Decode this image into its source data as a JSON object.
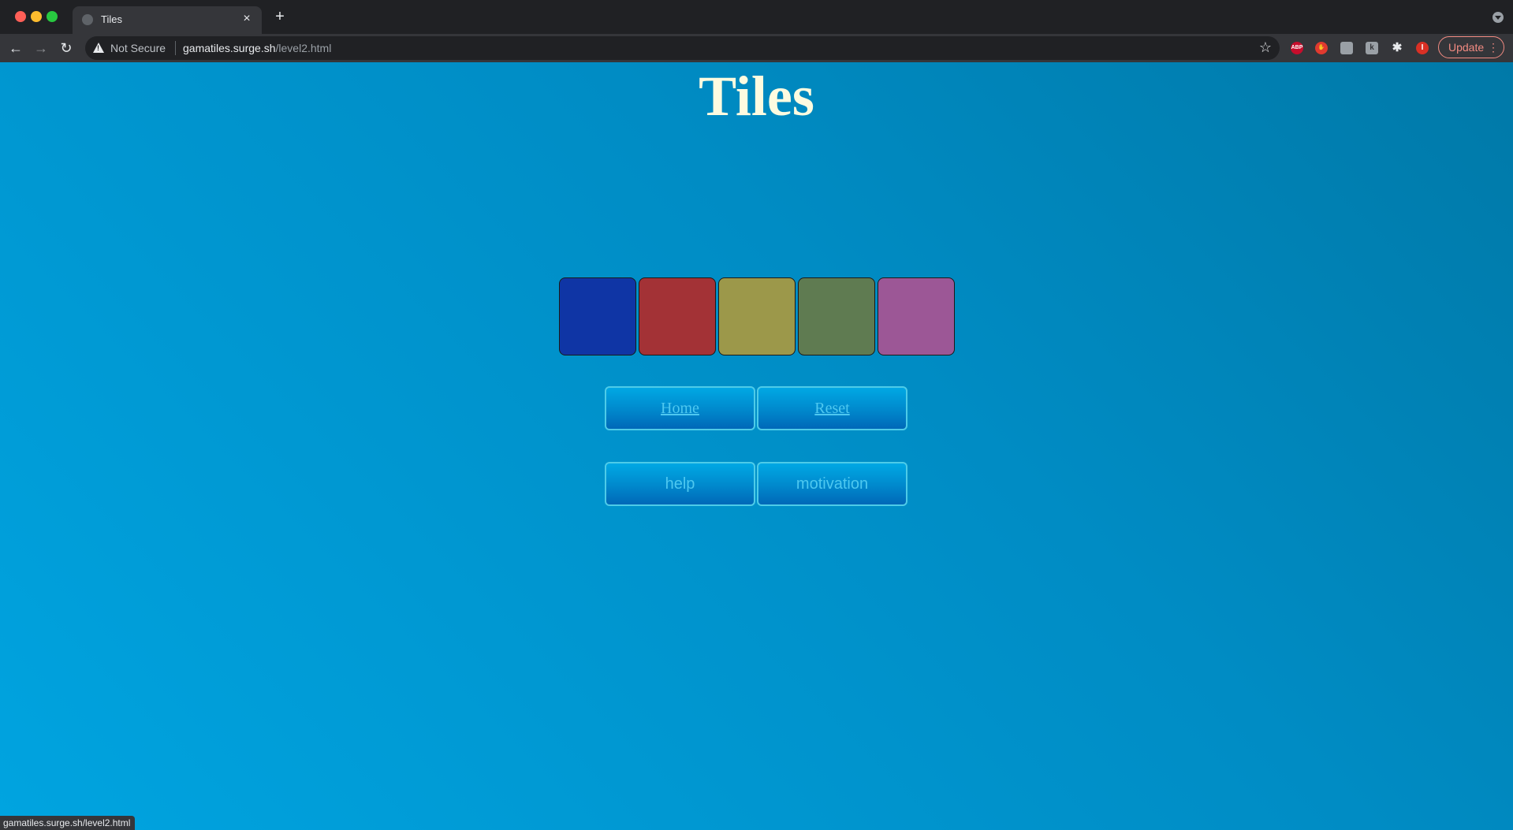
{
  "browser": {
    "tab": {
      "title": "Tiles",
      "close": "×"
    },
    "new_tab": "+",
    "nav": {
      "back": "←",
      "forward": "→",
      "reload": "↻"
    },
    "omnibox": {
      "security_label": "Not Secure",
      "url_host": "gamatiles.surge.sh",
      "url_path": "/level2.html",
      "star": "☆"
    },
    "extensions": [
      {
        "name": "adblock-plus-icon",
        "text": "ABP"
      },
      {
        "name": "hand-stop-icon",
        "text": "✋"
      },
      {
        "name": "print-icon",
        "text": ""
      },
      {
        "name": "k-extension-icon",
        "text": "k"
      },
      {
        "name": "puzzle-icon",
        "text": "✱"
      }
    ],
    "profile_initial": "I",
    "update_label": "Update",
    "status_bubble": "gamatiles.surge.sh/level2.html"
  },
  "page": {
    "title": "Tiles",
    "background_colors": [
      "#0079a8",
      "#00a4e0"
    ],
    "title_color": "#fdfbe0",
    "tiles": [
      {
        "color": "#0f35a5"
      },
      {
        "color": "#a33236"
      },
      {
        "color": "#9c984a"
      },
      {
        "color": "#5f7b51"
      },
      {
        "color": "#9c5796"
      }
    ],
    "buttons": {
      "home": "Home",
      "reset": "Reset",
      "help": "help",
      "motivation": "motivation"
    }
  }
}
